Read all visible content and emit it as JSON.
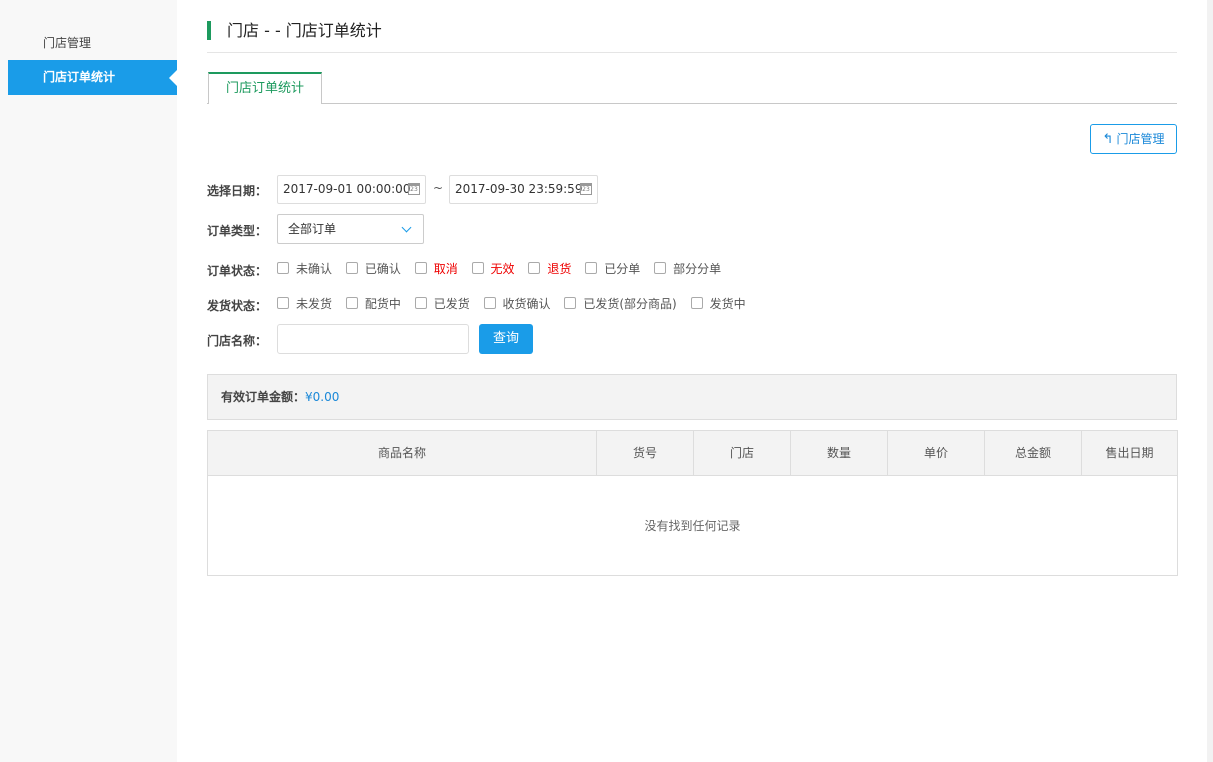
{
  "sidebar": {
    "items": [
      {
        "label": "门店管理",
        "active": false
      },
      {
        "label": "门店订单统计",
        "active": true
      }
    ]
  },
  "page": {
    "title": "门店 - - 门店订单统计",
    "tab": "门店订单统计",
    "back_button": "门店管理",
    "accent_color": "#1a9ce8",
    "tab_color": "#1d9a5e"
  },
  "filters": {
    "date_label": "选择日期：",
    "date_start": "2017-09-01 00:00:00",
    "date_end": "2017-09-30 23:59:59",
    "date_sep": "~",
    "order_type_label": "订单类型：",
    "order_type_value": "全部订单",
    "order_status_label": "订单状态：",
    "order_status_options": [
      "未确认",
      "已确认",
      "取消",
      "无效",
      "退货",
      "已分单",
      "部分分单"
    ],
    "ship_status_label": "发货状态：",
    "ship_status_options": [
      "未发货",
      "配货中",
      "已发货",
      "收货确认",
      "已发货(部分商品)",
      "发货中"
    ],
    "store_name_label": "门店名称：",
    "store_name_value": "",
    "query_button": "查询"
  },
  "summary": {
    "label": "有效订单金额：",
    "amount": "¥0.00"
  },
  "table": {
    "headers": [
      "商品名称",
      "货号",
      "门店",
      "数量",
      "单价",
      "总金额",
      "售出日期"
    ],
    "empty_text": "没有找到任何记录"
  }
}
